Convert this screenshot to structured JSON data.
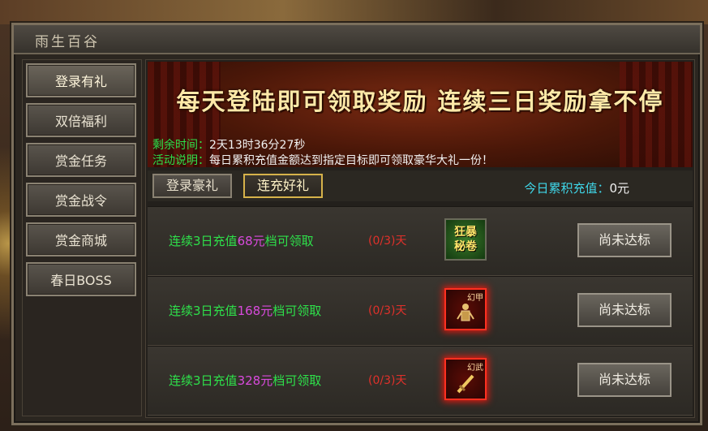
{
  "window": {
    "title": "雨生百谷"
  },
  "sidebar": {
    "items": [
      {
        "label": "登录有礼",
        "active": true
      },
      {
        "label": "双倍福利",
        "active": false
      },
      {
        "label": "赏金任务",
        "active": false
      },
      {
        "label": "赏金战令",
        "active": false
      },
      {
        "label": "赏金商城",
        "active": false
      },
      {
        "label": "春日BOSS",
        "active": false
      }
    ]
  },
  "banner": {
    "headline": "每天登陆即可领取奖励 连续三日奖励拿不停",
    "remaining_label": "剩余时间：",
    "remaining_value": "2天13时36分27秒",
    "desc_label": "活动说明：",
    "desc_value": "每日累积充值金额达到指定目标即可领取豪华大礼一份！"
  },
  "tabs": [
    {
      "label": "登录豪礼",
      "active": false
    },
    {
      "label": "连充好礼",
      "active": true
    }
  ],
  "today": {
    "label": "今日累积充值：",
    "value": "0元"
  },
  "rows": [
    {
      "prefix": "连续3日",
      "mid": "充值",
      "amount": "68元",
      "suffix": "档可领取",
      "progress": "(0/3)天",
      "reward_icon": "green-scroll-icon",
      "reward_text": "狂暴\n秘卷",
      "button": "尚未达标"
    },
    {
      "prefix": "连续3日",
      "mid": "充值",
      "amount": "168元",
      "suffix": "档可领取",
      "progress": "(0/3)天",
      "reward_icon": "phantom-armor-icon",
      "reward_label": "幻甲",
      "button": "尚未达标"
    },
    {
      "prefix": "连续3日",
      "mid": "充值",
      "amount": "328元",
      "suffix": "档可领取",
      "progress": "(0/3)天",
      "reward_icon": "phantom-weapon-icon",
      "reward_label": "幻武",
      "button": "尚未达标"
    }
  ],
  "colors": {
    "highlight_green": "#2ee04a",
    "amount_magenta": "#d84adc",
    "progress_red": "#e0302a",
    "today_cyan": "#3fd6e8",
    "banner_gold": "#ffe9a8"
  }
}
